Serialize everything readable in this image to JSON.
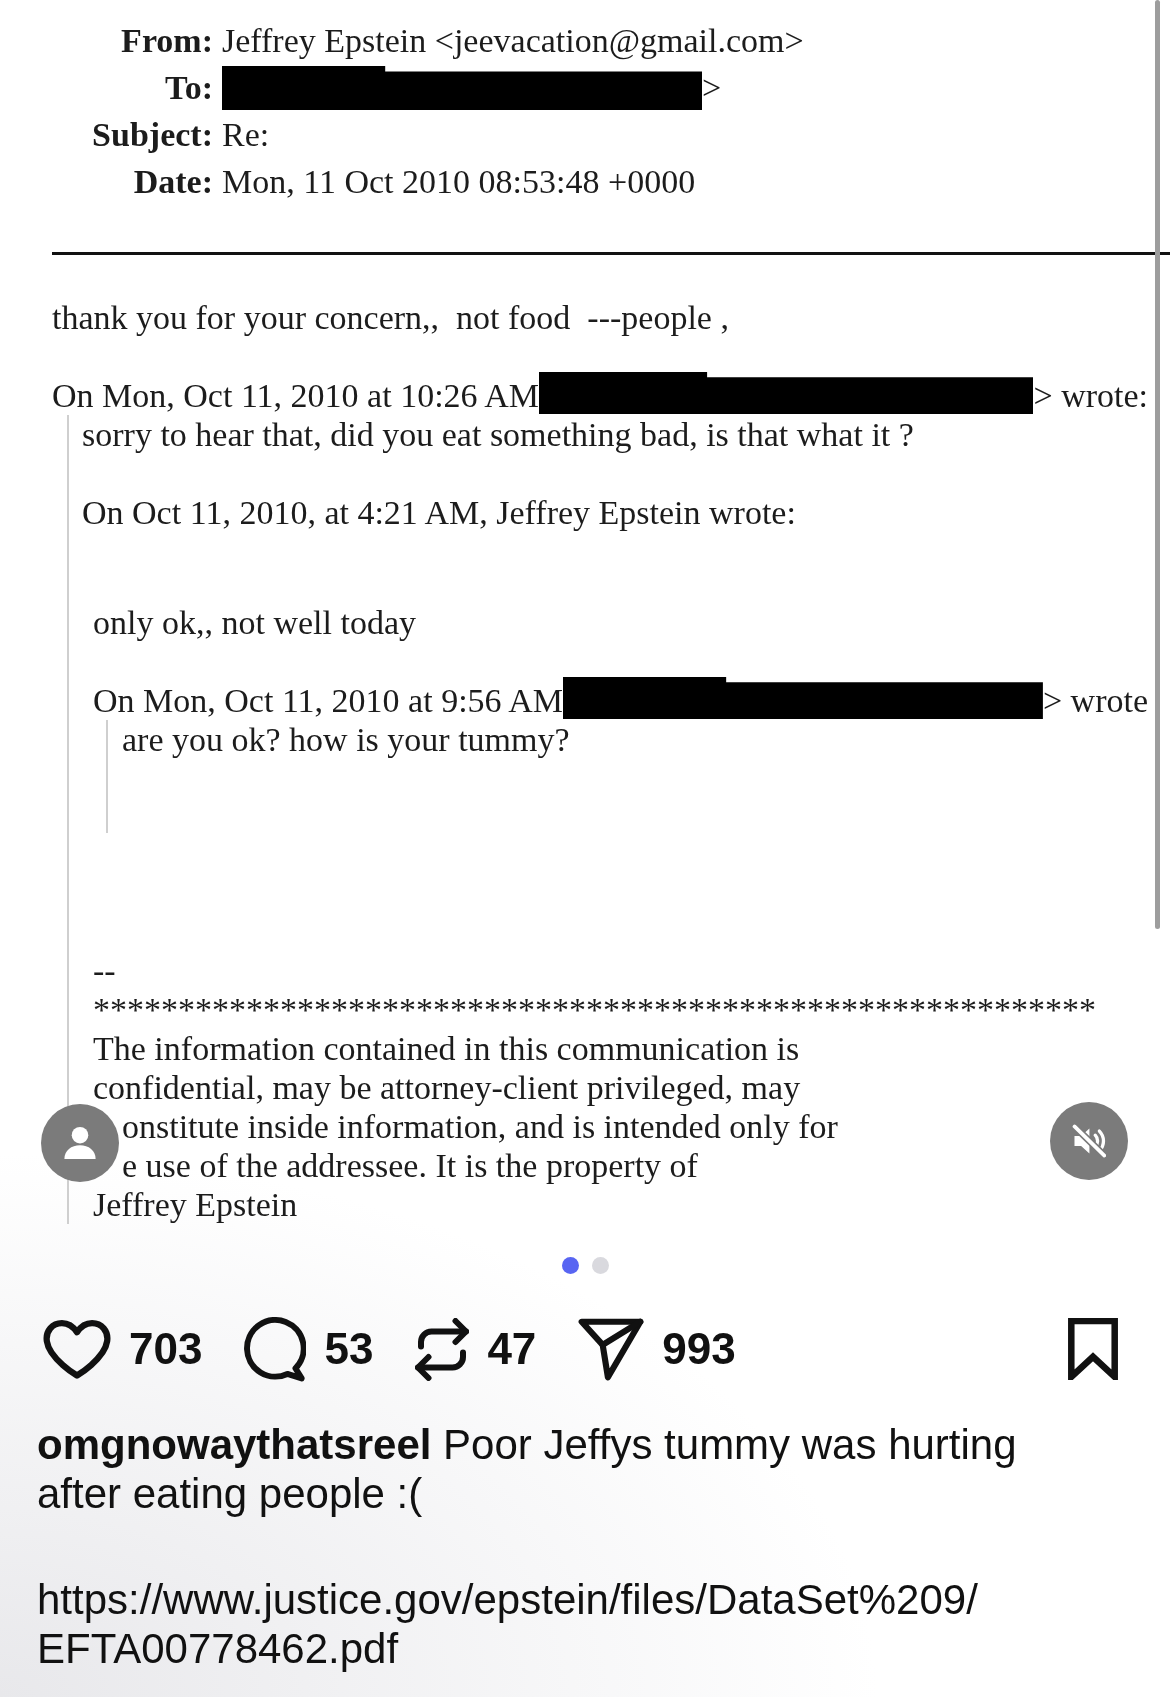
{
  "document": {
    "headers": [
      {
        "label": "From:",
        "redacted": false,
        "value": "Jeffrey Epstein <jeevacation@gmail.com>"
      },
      {
        "label": "To:",
        "redacted": true,
        "value": ">"
      },
      {
        "label": "Subject:",
        "redacted": false,
        "value": "Re:"
      },
      {
        "label": "Date:",
        "redacted": false,
        "value": "Mon, 11 Oct 2010 08:53:48 +0000"
      }
    ],
    "body": [
      {
        "kind": "text",
        "text": "thank you for your concern,,  not food  ---people ,"
      },
      {
        "kind": "attribution",
        "text": "On Mon, Oct 11, 2010 at 10:26 AM",
        "redacted": true,
        "after": "> wrote:"
      },
      {
        "kind": "quote",
        "children": [
          {
            "kind": "text",
            "text": "sorry to hear that, did you eat something bad, is that what it ?"
          },
          {
            "kind": "text",
            "text": "On Oct 11, 2010, at 4:21 AM, Jeffrey Epstein wrote:"
          },
          {
            "kind": "indent",
            "children": [
              {
                "kind": "text",
                "text": "only ok,, not well today"
              },
              {
                "kind": "attribution",
                "text": "On Mon, Oct 11, 2010 at 9:56 AM",
                "redacted": true,
                "after": "> wrote"
              },
              {
                "kind": "quote",
                "children": [
                  {
                    "kind": "text",
                    "text": "are you ok? how is your tummy?"
                  }
                ]
              },
              {
                "kind": "signature",
                "lines": [
                  "--",
                  "***********************************************************",
                  "The information contained in this communication is",
                  "confidential, may be attorney-client privileged, may",
                  "onstitute inside information, and is intended only for",
                  "e use of the addressee. It is the property of",
                  "Jeffrey Epstein"
                ]
              }
            ]
          }
        ]
      }
    ]
  },
  "overlay": {
    "muted": true
  },
  "carousel": [
    {
      "selected": true
    },
    {
      "selected": false
    }
  ],
  "actions": [
    {
      "kind": "like",
      "count": "703"
    },
    {
      "kind": "comment",
      "count": "53"
    },
    {
      "kind": "repost",
      "count": "47"
    },
    {
      "kind": "share",
      "count": "993"
    }
  ],
  "caption": {
    "username": "omgnowaythatsreel",
    "text": "Poor Jeffys tummy was hurting after eating people :(",
    "url": "https://www.justice.gov/epstein/files/DataSet%209/EFTA00778462.pdf"
  }
}
